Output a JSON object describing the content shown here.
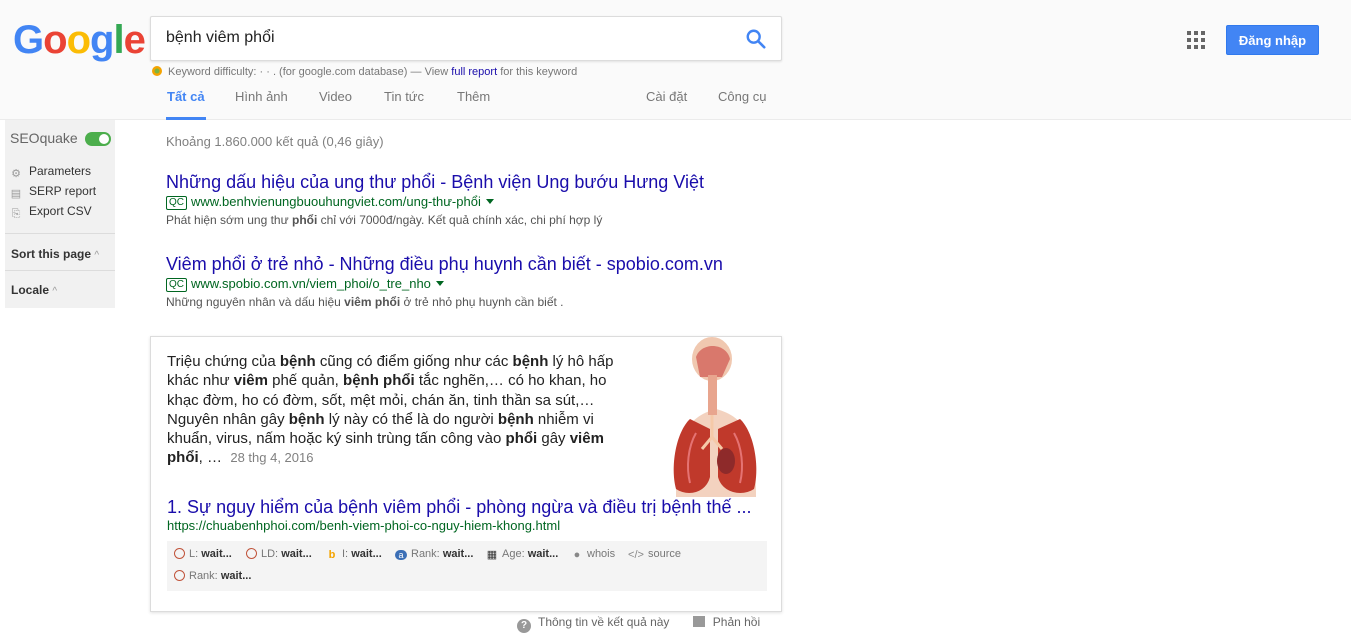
{
  "logo": {
    "text": "Google"
  },
  "search": {
    "query": "bệnh viêm phổi"
  },
  "keyword_difficulty": {
    "prefix": "Keyword difficulty: · · . (for google.com database) — View ",
    "link": "full report",
    "suffix": " for this keyword"
  },
  "tabs": {
    "all": "Tất cả",
    "images": "Hình ảnh",
    "video": "Video",
    "news": "Tin tức",
    "more": "Thêm",
    "settings": "Cài đặt",
    "tools": "Công cụ"
  },
  "header": {
    "signin": "Đăng nhập"
  },
  "sidebar": {
    "title": "SEOquake",
    "parameters": "Parameters",
    "serp_report": "SERP report",
    "export_csv": "Export CSV",
    "sort_this_page": "Sort this page",
    "locale": "Locale"
  },
  "stats": "Khoảng 1.860.000 kết quả (0,46 giây)",
  "ads": [
    {
      "title": "Những dấu hiệu của ung thư phổi - Bệnh viện Ung bướu Hưng Việt",
      "badge": "QC",
      "url": "www.benhvienungbuouhungviet.com/ung-thư-phổi",
      "desc_a": "Phát hiện sớm ung thư ",
      "desc_b": "phổi",
      "desc_c": " chỉ với 7000đ/ngày. Kết quả chính xác, chi phí hợp lý"
    },
    {
      "title": "Viêm phổi ở trẻ nhỏ - Những điều phụ huynh cần biết - spobio.com.vn",
      "badge": "QC",
      "url": "www.spobio.com.vn/viem_phoi/o_tre_nho",
      "desc_a": "Những nguyên nhân và dấu hiệu ",
      "desc_b": "viêm phổi",
      "desc_c": " ở trẻ nhỏ phụ huynh cần biết ."
    }
  ],
  "featured": {
    "s1": "Triệu chứng của ",
    "b1": "bệnh",
    "s2": " cũng có điểm giống như các ",
    "b2": "bệnh",
    "s3": " lý hô hấp khác như ",
    "b3": "viêm",
    "s4": " phế quản, ",
    "b4": "bệnh phổi",
    "s5": " tắc nghẽn,… có ho khan, ho khạc đờm, ho có đờm, sốt, mệt mỏi, chán ăn, tinh thần sa sút,… Nguyên nhân gây ",
    "b5": "bệnh",
    "s6": " lý này có thể là do người ",
    "b6": "bệnh",
    "s7": " nhiễm vi khuẩn, virus, nấm hoặc ký sinh trùng tấn công vào ",
    "b7": "phổi",
    "s8": " gây ",
    "b8": "viêm phổi",
    "s9": ", …",
    "date": "28 thg 4, 2016",
    "title": "1. Sự nguy hiểm của bệnh viêm phổi - phòng ngừa và điều trị bệnh thế ...",
    "url": "https://chuabenhphoi.com/benh-viem-phoi-co-nguy-hiem-khong.html"
  },
  "seoquake_bar": {
    "l_label": "L:",
    "l_val": "wait...",
    "ld_label": "LD:",
    "ld_val": "wait...",
    "i_label": "I:",
    "i_val": "wait...",
    "rank_label": "Rank:",
    "rank_val": "wait...",
    "age_label": "Age:",
    "age_val": "wait...",
    "whois": "whois",
    "source": "source",
    "rank2_label": "Rank:",
    "rank2_val": "wait..."
  },
  "footer": {
    "about": "Thông tin về kết quả này",
    "feedback": "Phản hồi"
  },
  "colors": {
    "link": "#1a0dab",
    "url": "#006621",
    "accent": "#4285f4",
    "toggle": "#4cae4c"
  }
}
